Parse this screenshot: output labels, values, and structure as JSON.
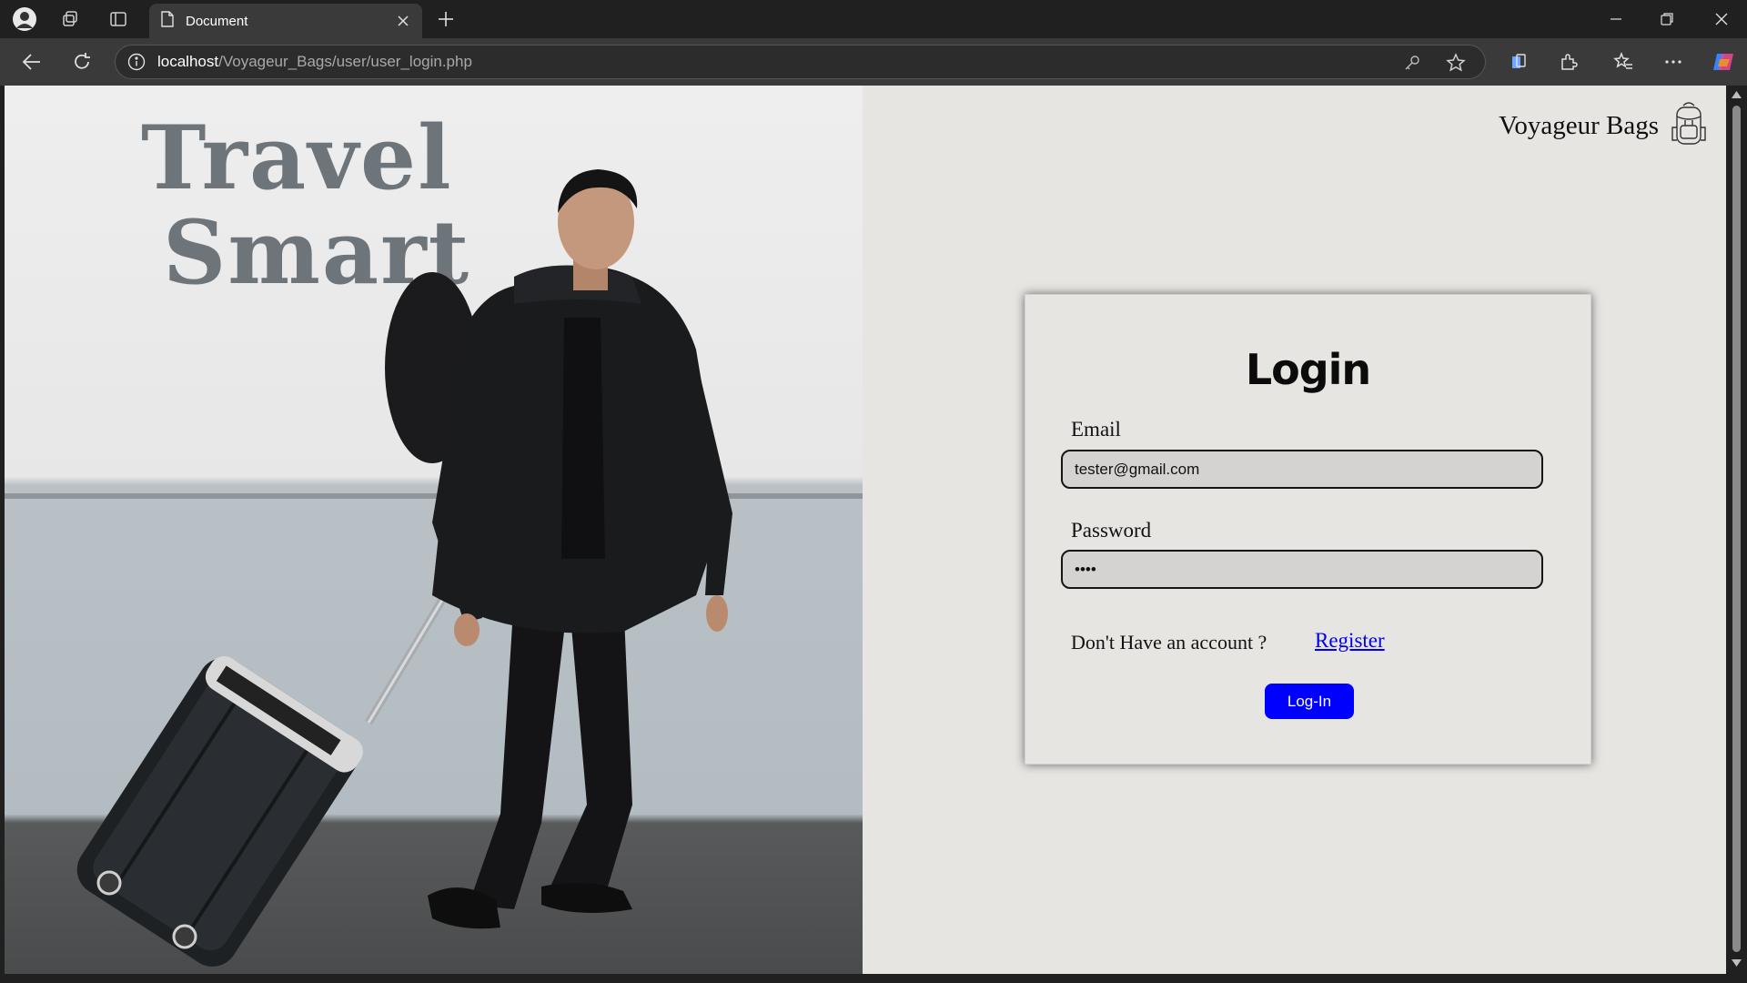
{
  "browser": {
    "tab_title": "Document",
    "url_host": "localhost",
    "url_path": "/Voyageur_Bags/user/user_login.php"
  },
  "hero": {
    "line1": "Travel",
    "line2": "Smart"
  },
  "brand": {
    "name": "Voyageur Bags",
    "icon": "backpack-icon"
  },
  "login": {
    "title": "Login",
    "email_label": "Email",
    "email_value": "tester@gmail.com",
    "password_label": "Password",
    "password_value": "••••",
    "account_prompt": "Don't Have an account ?",
    "register_label": "Register",
    "submit_label": "Log-In"
  },
  "colors": {
    "accent": "#0000ff",
    "link": "#0000ee",
    "page_bg": "#e6e5e2"
  }
}
